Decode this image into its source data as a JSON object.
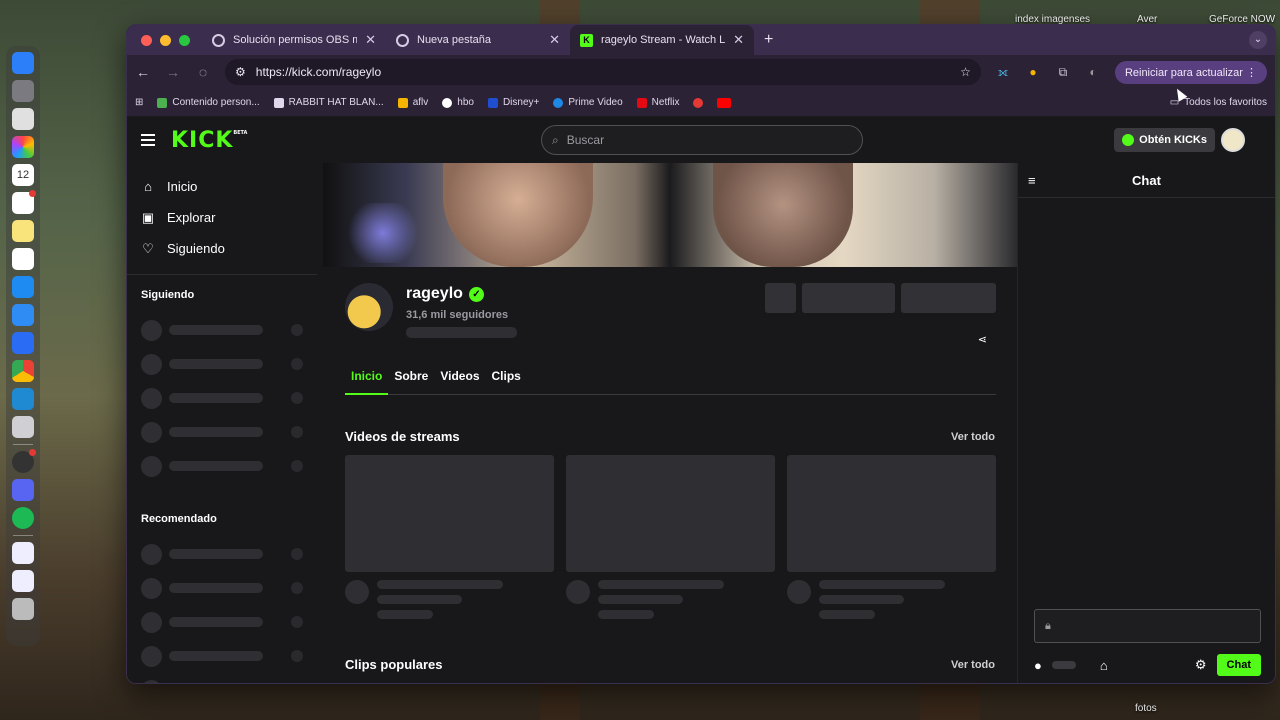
{
  "desktop": {
    "labels": [
      "index imagenses",
      "Aver",
      "GeForce NOW"
    ],
    "bottom_label": "fotos",
    "dock_icons": [
      "finder-icon",
      "system-settings-icon",
      "launchpad-icon",
      "photos-icon",
      "calendar-icon",
      "reminders-icon",
      "notes-icon",
      "freeform-icon",
      "app-store-icon",
      "safari-icon",
      "roblox-icon",
      "chrome-icon",
      "vscode-icon",
      "phone-mirror-icon",
      "activity-monitor-icon",
      "discord-icon",
      "spotify-icon",
      "document-icon",
      "document-icon-2",
      "trash-icon"
    ],
    "calendar_day": "12"
  },
  "browser": {
    "tabs": [
      {
        "title": "Solución permisos OBS macOS",
        "active": false
      },
      {
        "title": "Nueva pestaña",
        "active": false
      },
      {
        "title": "rageylo Stream - Watch Live on Kick",
        "active": true
      }
    ],
    "new_tab": "+",
    "url": "https://kick.com/rageylo",
    "restart_label": "Reiniciar para actualizar",
    "bookmarks": [
      {
        "label": "Contenido person...",
        "color": "#4caf50"
      },
      {
        "label": "RABBIT HAT BLAN...",
        "color": "#e0d7ec"
      },
      {
        "label": "aflv",
        "color": "#f4b400"
      },
      {
        "label": "hbo",
        "color": "#ffffff"
      },
      {
        "label": "Disney+",
        "color": "#1f4fcf"
      },
      {
        "label": "Prime Video",
        "color": "#1e88e5"
      },
      {
        "label": "Netflix",
        "color": "#e50914"
      },
      {
        "label": "",
        "color": "#e53935"
      },
      {
        "label": "",
        "color": "#ff0000"
      }
    ],
    "all_bookmarks": "Todos los favoritos"
  },
  "kick": {
    "logo": "KICK",
    "logo_beta": "BETA",
    "search_placeholder": "Buscar",
    "kicks_button": "Obtén KICKs",
    "nav": [
      {
        "label": "Inicio",
        "icon": "home-icon"
      },
      {
        "label": "Explorar",
        "icon": "compass-icon"
      },
      {
        "label": "Siguiendo",
        "icon": "heart-icon"
      }
    ],
    "following_heading": "Siguiendo",
    "recommended_heading": "Recomendado",
    "channel": {
      "name": "rageylo",
      "followers": "31,6 mil seguidores"
    },
    "tabs": [
      {
        "label": "Inicio",
        "active": true
      },
      {
        "label": "Sobre",
        "active": false
      },
      {
        "label": "Videos",
        "active": false
      },
      {
        "label": "Clips",
        "active": false
      }
    ],
    "sections": {
      "streams_title": "Videos de streams",
      "streams_more": "Ver todo",
      "clips_title": "Clips populares",
      "clips_more": "Ver todo"
    },
    "chat": {
      "title": "Chat",
      "send_label": "Chat"
    }
  },
  "colors": {
    "accent": "#53fc18",
    "browser_chrome": "#3a2d4d",
    "page_bg": "#18181b"
  }
}
